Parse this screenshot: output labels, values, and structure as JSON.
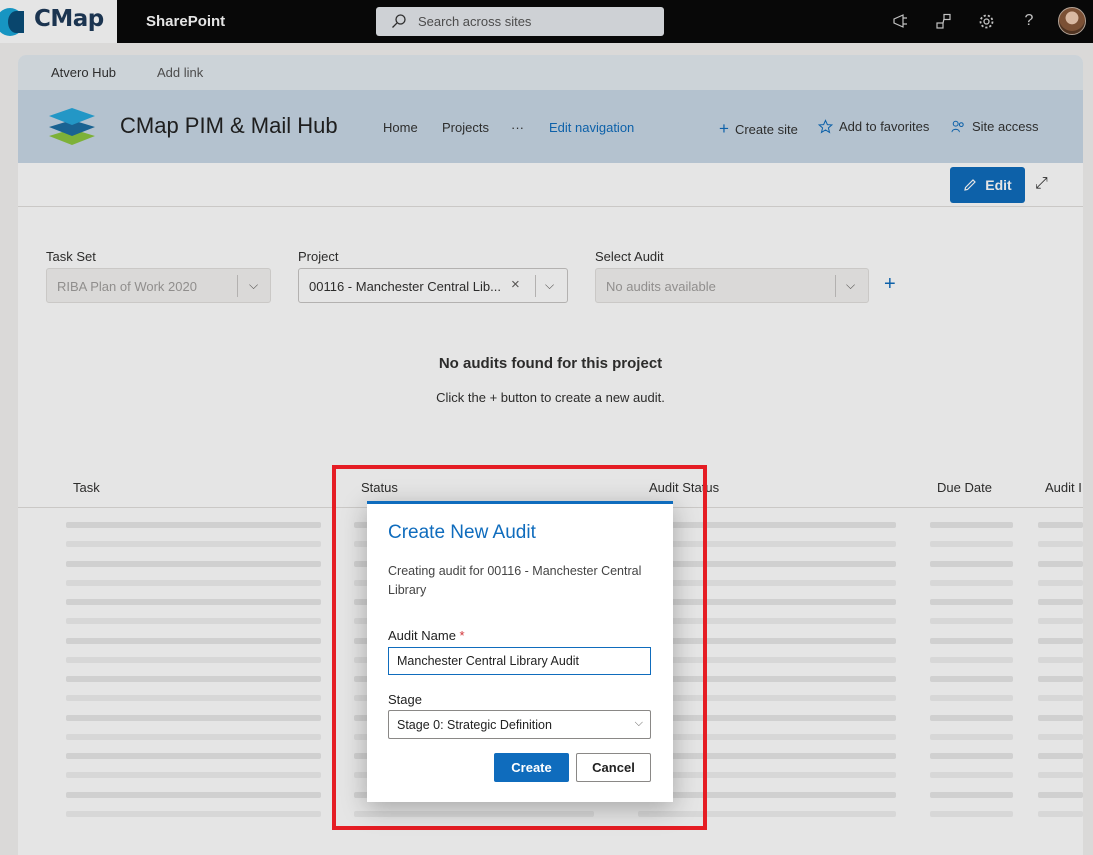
{
  "suitebar": {
    "brand": "CMap",
    "app_name": "SharePoint",
    "search_placeholder": "Search across sites",
    "icons": [
      "megaphone-icon",
      "share-icon",
      "settings-icon",
      "help-icon",
      "avatar"
    ]
  },
  "hubbar": {
    "hub_name": "Atvero Hub",
    "add_link": "Add link"
  },
  "site": {
    "title": "CMap PIM & Mail Hub",
    "nav": [
      "Home",
      "Projects",
      "···",
      "Edit navigation"
    ],
    "actions": {
      "create_site": "Create site",
      "add_favorites": "Add to favorites",
      "site_access": "Site access"
    }
  },
  "cmdbar": {
    "edit_label": "Edit"
  },
  "filters": {
    "task_set_label": "Task Set",
    "task_set_value": "RIBA Plan of Work 2020",
    "project_label": "Project",
    "project_value": "00116 - Manchester Central Lib...",
    "audit_label": "Select Audit",
    "audit_value": "No audits available"
  },
  "empty": {
    "title": "No audits found for this project",
    "subtitle": "Click the + button to create a new audit."
  },
  "table": {
    "headers": [
      "Task",
      "Status",
      "Audit Status",
      "Due Date",
      "Audit I"
    ]
  },
  "dialog": {
    "title": "Create New Audit",
    "description": "Creating audit for 00116 - Manchester Central Library",
    "name_label": "Audit Name",
    "required_mark": "*",
    "name_value": "Manchester Central Library Audit",
    "stage_label": "Stage",
    "stage_value": "Stage 0: Strategic Definition",
    "create_label": "Create",
    "cancel_label": "Cancel"
  },
  "colors": {
    "accent": "#0f6cbd",
    "highlight": "#e51d24",
    "header_bg": "#c9d9e7"
  }
}
